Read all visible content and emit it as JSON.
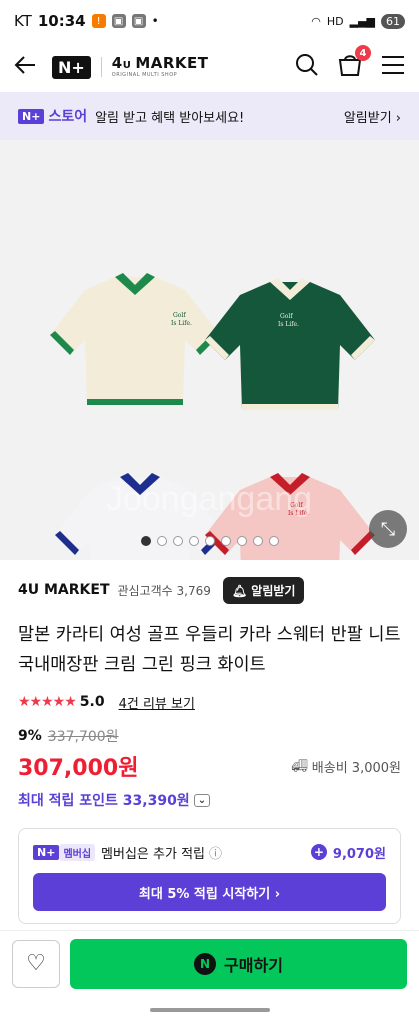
{
  "status": {
    "carrier": "KT",
    "time": "10:34",
    "signal": "HD",
    "battery": "61"
  },
  "nav": {
    "back_icon": "arrow-left-icon",
    "logo_n": "N+",
    "brand_name": "MARKET",
    "brand_prefix": "4",
    "brand_sub": "ORIGINAL MULTI SHOP",
    "cart_count": "4"
  },
  "promo": {
    "badge": "N+",
    "store": "스토어",
    "message": "알림 받고 혜택 받아보세요!",
    "action": "알림받기 ›"
  },
  "gallery": {
    "watermark": "Joongangang",
    "page_total": 9,
    "page_current": 1,
    "shirt_colors": [
      "#f3ecd9",
      "#14573a",
      "#f4f4f7",
      "#f4c6c4"
    ],
    "collar_colors": [
      "#1d8a4c",
      "#f3ecd9",
      "#1e2e8f",
      "#c41e2a"
    ],
    "logo_text_1": "Golf",
    "logo_text_2": "Is Life."
  },
  "product": {
    "store_name": "4U MARKET",
    "interest_label": "관심고객수 3,769",
    "alarm_button": "알림받기",
    "title": "말본 카라티 여성 골프 우들리 카라 스웨터 반팔 니트 국내매장판 크림 그린 핑크 화이트",
    "rating": "5.0",
    "review_link": "4건 리뷰 보기",
    "discount": "9%",
    "original_price": "337,700원",
    "price": "307,000원",
    "shipping": "배송비 3,000원",
    "points": "최대 적립 포인트 33,390원"
  },
  "membership": {
    "badge_n": "N+",
    "badge_text": "멤버십",
    "text": "멤버십은 추가 적립",
    "points": "9,070원",
    "button": "최대 5% 적립 시작하기 ›"
  },
  "bottom": {
    "buy_label": "구매하기",
    "buy_icon": "N"
  }
}
